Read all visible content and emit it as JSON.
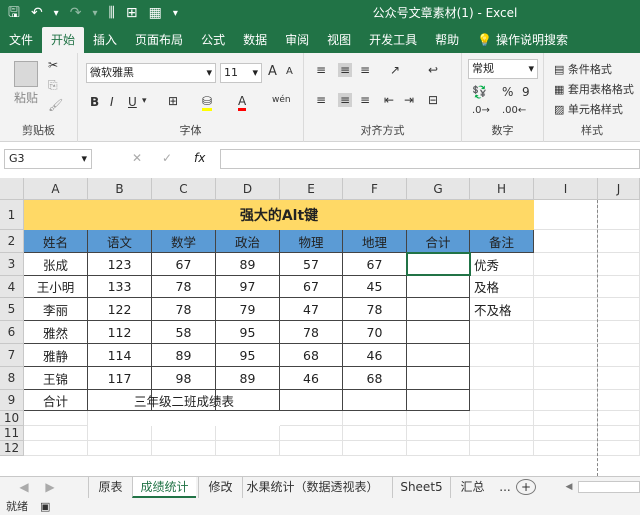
{
  "window": {
    "title": "公众号文章素材(1)  -  Excel"
  },
  "quick_access": {
    "save": "🖫",
    "undo": "↶",
    "undo_menu": "▾",
    "redo": "↷",
    "redo_menu": "▾",
    "cmd1": "⫼",
    "cmd2": "⊞",
    "cmd3": "▦",
    "customize": "▾"
  },
  "tabs": [
    "文件",
    "开始",
    "插入",
    "页面布局",
    "公式",
    "数据",
    "审阅",
    "视图",
    "开发工具",
    "帮助"
  ],
  "tell_me": "操作说明搜索",
  "ribbon": {
    "clipboard": {
      "paste": "粘贴",
      "label": "剪贴板"
    },
    "font": {
      "name": "微软雅黑",
      "size": "11",
      "label": "字体",
      "bold": "B",
      "italic": "I",
      "underline": "U",
      "underline_menu": "▾",
      "grow": "A",
      "shrink": "A",
      "font_color": "A",
      "phonetic": "wén"
    },
    "alignment": {
      "label": "对齐方式"
    },
    "number": {
      "format": "常规",
      "percent": "%",
      "comma": "9",
      "label": "数字"
    },
    "styles": {
      "cond": "条件格式",
      "table": "套用表格格式",
      "cell": "单元格样式",
      "label": "样式"
    }
  },
  "formula_bar": {
    "cell": "G3",
    "cancel": "✕",
    "enter": "✓",
    "fx": "fx",
    "value": ""
  },
  "columns": [
    "A",
    "B",
    "C",
    "D",
    "E",
    "F",
    "G",
    "H",
    "I",
    "J"
  ],
  "rows": [
    "1",
    "2",
    "3",
    "4",
    "5",
    "6",
    "7",
    "8",
    "9",
    "10",
    "11",
    "12"
  ],
  "sheet": {
    "title": "强大的Alt键",
    "headers": [
      "姓名",
      "语文",
      "数学",
      "政治",
      "物理",
      "地理",
      "合计",
      "备注"
    ],
    "data": [
      [
        "张成",
        "123",
        "67",
        "89",
        "57",
        "67",
        "",
        "优秀"
      ],
      [
        "王小明",
        "133",
        "78",
        "97",
        "67",
        "45",
        "",
        "及格"
      ],
      [
        "李丽",
        "122",
        "78",
        "79",
        "47",
        "78",
        "",
        "不及格"
      ],
      [
        "雅然",
        "112",
        "58",
        "95",
        "78",
        "70",
        "",
        ""
      ],
      [
        "雅静",
        "114",
        "89",
        "95",
        "68",
        "46",
        "",
        ""
      ],
      [
        "王锦",
        "117",
        "98",
        "89",
        "46",
        "68",
        "",
        ""
      ],
      [
        "合计",
        "",
        "",
        "",
        "",
        "",
        "",
        ""
      ]
    ],
    "caption": "三年级二班成绩表",
    "colors": {
      "title_fill": "#FFD966",
      "header_fill": "#5B9BD5"
    }
  },
  "sheet_tabs": [
    "原表",
    "成绩统计",
    "修改",
    "水果统计（数据透视表）",
    "Sheet5",
    "汇总"
  ],
  "sheet_nav": {
    "prev": "◀",
    "next": "▶",
    "more": "...",
    "add": "+",
    "hscroll_left": "◀"
  },
  "status": "就绪"
}
